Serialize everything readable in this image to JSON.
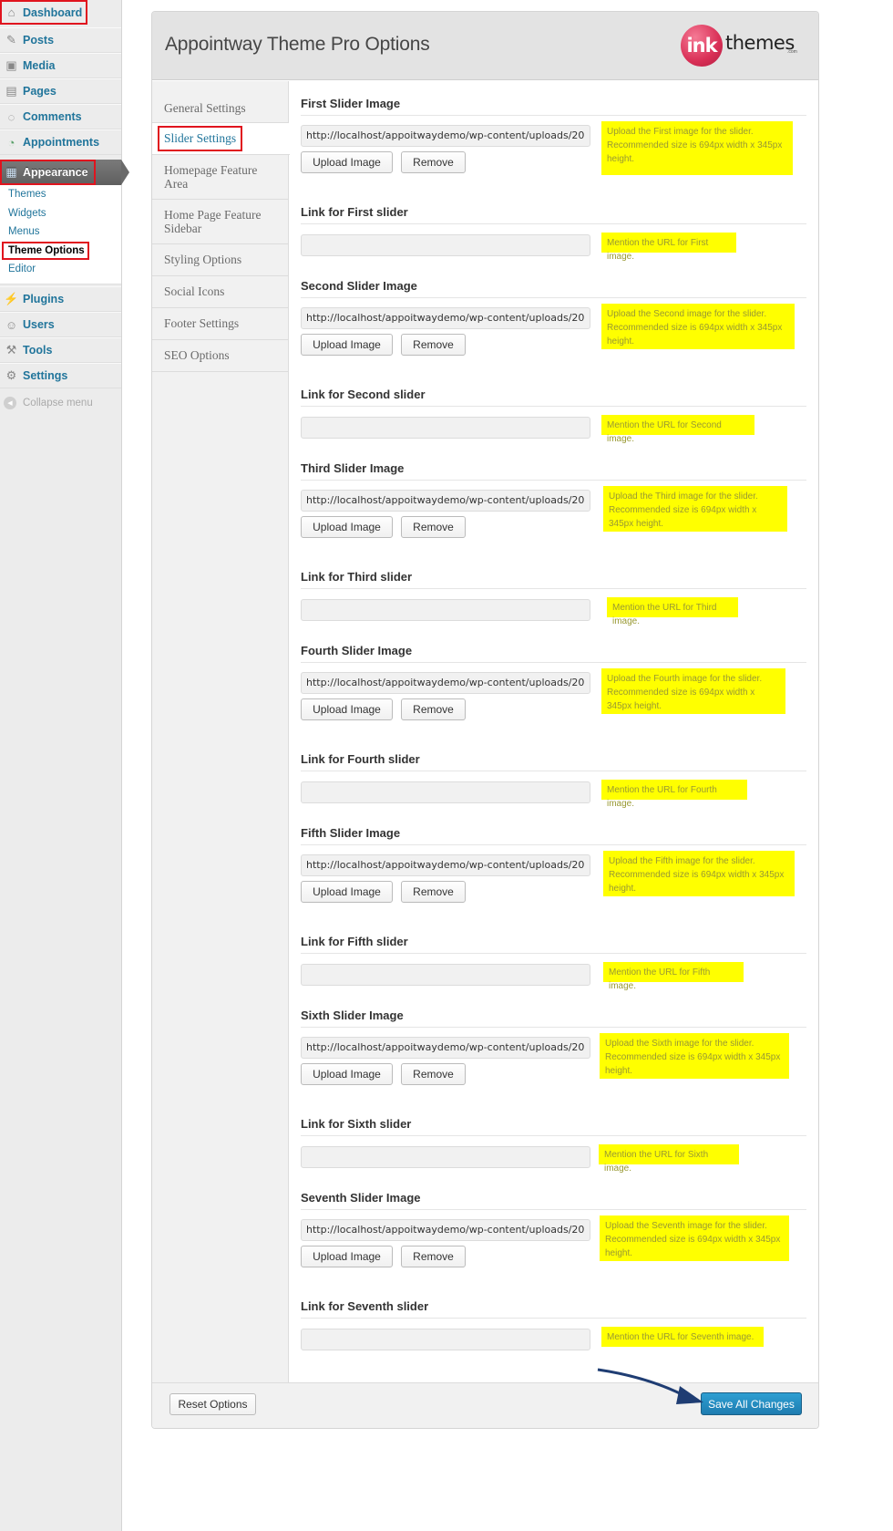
{
  "sidebar": {
    "items": [
      {
        "label": "Dashboard",
        "icon": "home-icon"
      },
      {
        "label": "Posts",
        "icon": "pushpin-icon"
      },
      {
        "label": "Media",
        "icon": "media-icon"
      },
      {
        "label": "Pages",
        "icon": "pages-icon"
      },
      {
        "label": "Comments",
        "icon": "speech-bubble-icon"
      },
      {
        "label": "Appointments",
        "icon": "clock-calendar-icon"
      },
      {
        "label": "Appearance",
        "icon": "appearance-icon"
      },
      {
        "label": "Plugins",
        "icon": "plug-icon"
      },
      {
        "label": "Users",
        "icon": "users-icon"
      },
      {
        "label": "Tools",
        "icon": "tools-icon"
      },
      {
        "label": "Settings",
        "icon": "settings-icon"
      }
    ],
    "submenu": [
      "Themes",
      "Widgets",
      "Menus",
      "Theme Options",
      "Editor"
    ],
    "collapse_label": "Collapse menu"
  },
  "panel": {
    "title": "Appointway Theme Pro Options",
    "logo": {
      "mark": "ink",
      "word": "themes",
      "suffix": ".com"
    },
    "tabs": [
      "General Settings",
      "Slider Settings",
      "Homepage Feature Area",
      "Home Page Feature Sidebar",
      "Styling Options",
      "Social Icons",
      "Footer Settings",
      "SEO Options"
    ],
    "active_tab": "Slider Settings",
    "image_url_value": "http://localhost/appoitwaydemo/wp-content/uploads/20",
    "upload_label": "Upload Image",
    "remove_label": "Remove",
    "sliders": [
      {
        "image_title": "First Slider Image",
        "image_hint": "Upload the First image for the slider. Recommended size is 694px width x 345px height.",
        "link_title": "Link for First slider",
        "link_hint": "Mention the URL for First image.",
        "link_value": ""
      },
      {
        "image_title": "Second Slider Image",
        "image_hint": "Upload the Second image for the slider. Recommended size is 694px width x 345px height.",
        "link_title": "Link for Second slider",
        "link_hint": "Mention the URL for Second image.",
        "link_value": ""
      },
      {
        "image_title": "Third Slider Image",
        "image_hint": "Upload the Third image for the slider. Recommended size is 694px width x 345px height.",
        "link_title": "Link for Third slider",
        "link_hint": "Mention the URL for Third image.",
        "link_value": ""
      },
      {
        "image_title": "Fourth Slider Image",
        "image_hint": "Upload the Fourth image for the slider. Recommended size is 694px width x 345px height.",
        "link_title": "Link for Fourth slider",
        "link_hint": "Mention the URL for Fourth image.",
        "link_value": ""
      },
      {
        "image_title": "Fifth Slider Image",
        "image_hint": "Upload the Fifth image for the slider. Recommended size is 694px width x 345px height.",
        "link_title": "Link for Fifth slider",
        "link_hint": "Mention the URL for Fifth image.",
        "link_value": ""
      },
      {
        "image_title": "Sixth Slider Image",
        "image_hint": "Upload the Sixth image for the slider. Recommended size is 694px width x 345px height.",
        "link_title": "Link for Sixth slider",
        "link_hint": "Mention the URL for Sixth image.",
        "link_value": ""
      },
      {
        "image_title": "Seventh Slider Image",
        "image_hint": "Upload the Seventh image for the slider. Recommended size is 694px width x 345px height.",
        "link_title": "Link for Seventh slider",
        "link_hint": "Mention the URL for Seventh image.",
        "link_value": ""
      }
    ],
    "reset_label": "Reset Options",
    "save_label": "Save All Changes"
  },
  "colors": {
    "link_blue": "#21759b",
    "hint_yellow": "#ffff00",
    "highlight_red": "#e0141e",
    "save_blue": "#2488bf",
    "arrow_navy": "#1f3d73"
  }
}
